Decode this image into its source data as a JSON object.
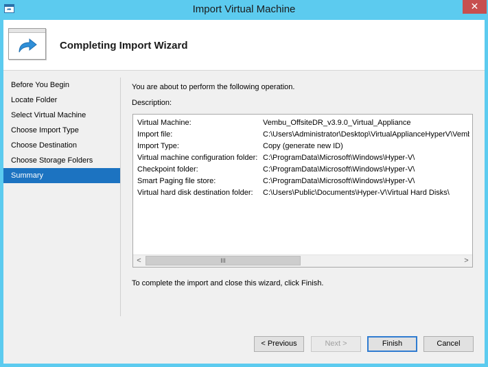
{
  "window": {
    "title": "Import Virtual Machine",
    "close_label": "✕"
  },
  "header": {
    "title": "Completing Import Wizard"
  },
  "nav": {
    "items": [
      {
        "label": "Before You Begin"
      },
      {
        "label": "Locate Folder"
      },
      {
        "label": "Select Virtual Machine"
      },
      {
        "label": "Choose Import Type"
      },
      {
        "label": "Choose Destination"
      },
      {
        "label": "Choose Storage Folders"
      },
      {
        "label": "Summary"
      }
    ],
    "active": "Summary"
  },
  "content": {
    "intro": "You are about to perform the following operation.",
    "description_label": "Description:",
    "rows": [
      {
        "key": "Virtual Machine:",
        "value": "Vembu_OffsiteDR_v3.9.0_Virtual_Appliance"
      },
      {
        "key": "Import file:",
        "value": "C:\\Users\\Administrator\\Desktop\\VirtualApplianceHyperV\\Vembu"
      },
      {
        "key": "Import Type:",
        "value": "Copy (generate new ID)"
      },
      {
        "key": "Virtual machine configuration folder:",
        "value": "C:\\ProgramData\\Microsoft\\Windows\\Hyper-V\\"
      },
      {
        "key": "Checkpoint folder:",
        "value": "C:\\ProgramData\\Microsoft\\Windows\\Hyper-V\\"
      },
      {
        "key": "Smart Paging file store:",
        "value": "C:\\ProgramData\\Microsoft\\Windows\\Hyper-V\\"
      },
      {
        "key": "Virtual hard disk destination folder:",
        "value": "C:\\Users\\Public\\Documents\\Hyper-V\\Virtual Hard Disks\\"
      }
    ],
    "finish_text": "To complete the import and close this wizard, click Finish."
  },
  "scrollbar": {
    "left_arrow": "<",
    "right_arrow": ">",
    "thumb_grip": "III"
  },
  "buttons": {
    "previous": "< Previous",
    "next": "Next >",
    "finish": "Finish",
    "cancel": "Cancel"
  },
  "colors": {
    "title_bar": "#5ccbef",
    "close_button": "#c74f4f",
    "nav_selected": "#1c73c1"
  }
}
